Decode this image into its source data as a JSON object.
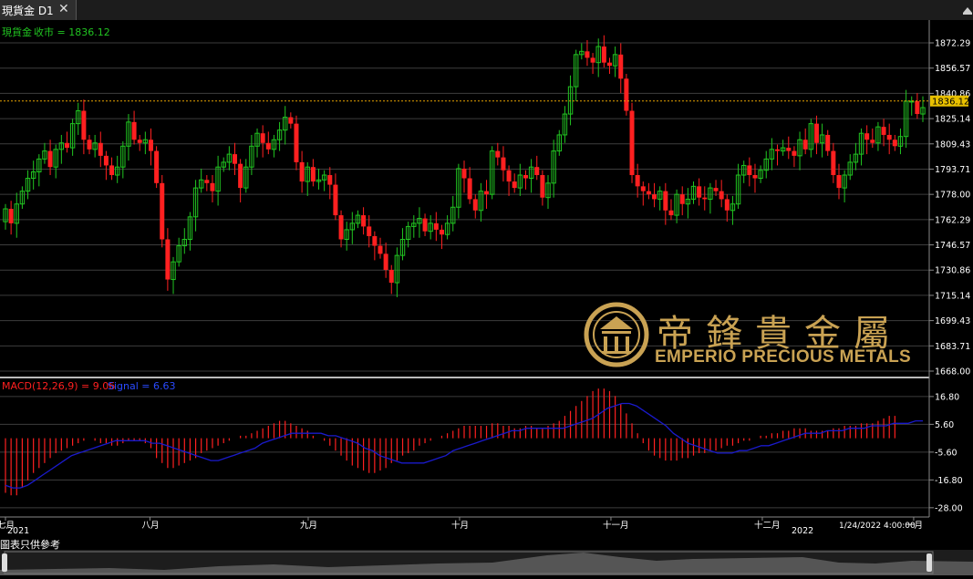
{
  "window": {
    "tab_title": "現貨金 D1",
    "close_glyph": "✕"
  },
  "price_panel": {
    "label_symbol": "現貨金",
    "label_text": "收市 = 1836.12",
    "label_color": "#21c421",
    "current_price": "1836.12",
    "current_line_color": "#e8a400"
  },
  "macd_panel": {
    "label_prefix": "MACD(12,26,9) = 9.06",
    "label_signal": "Signal = 6.63",
    "macd_color": "#ff2020",
    "signal_color": "#1a1acc"
  },
  "footer_note": "圖表只供參考",
  "timestamp": "1/24/2022 4:00:00",
  "logo": {
    "cn_text": "帝鋒貴金屬",
    "en_text": "EMPERIO PRECIOUS METALS",
    "color": "#c9a253"
  },
  "chart_data": [
    {
      "type": "candlestick",
      "title": "現貨金 D1",
      "series_label": "收市 = 1836.12",
      "ylim": [
        1668.0,
        1880.0
      ],
      "ytick_labels": [
        "1872.29",
        "1856.57",
        "1840.86",
        "1825.14",
        "1809.43",
        "1793.71",
        "1778.00",
        "1762.29",
        "1746.57",
        "1730.86",
        "1715.14",
        "1699.43",
        "1683.71",
        "1668.00"
      ],
      "xtick_labels": [
        "七月",
        "八月",
        "九月",
        "十月",
        "十一月",
        "十二月",
        "一月"
      ],
      "year_labels": [
        "2021",
        "2022"
      ],
      "colors": {
        "up": "#21c421",
        "down": "#ff2020"
      },
      "grid": true,
      "current": 1836.12,
      "close": [
        1769,
        1760,
        1772,
        1780,
        1788,
        1792,
        1800,
        1805,
        1795,
        1806,
        1810,
        1807,
        1822,
        1830,
        1812,
        1806,
        1810,
        1802,
        1796,
        1790,
        1795,
        1808,
        1823,
        1812,
        1810,
        1812,
        1805,
        1785,
        1750,
        1725,
        1736,
        1746,
        1750,
        1764,
        1782,
        1787,
        1785,
        1780,
        1795,
        1798,
        1803,
        1797,
        1782,
        1795,
        1808,
        1816,
        1810,
        1806,
        1812,
        1818,
        1826,
        1822,
        1798,
        1786,
        1795,
        1786,
        1787,
        1790,
        1784,
        1765,
        1750,
        1756,
        1760,
        1765,
        1758,
        1752,
        1746,
        1741,
        1731,
        1723,
        1740,
        1750,
        1758,
        1760,
        1763,
        1755,
        1760,
        1756,
        1753,
        1760,
        1770,
        1794,
        1788,
        1775,
        1768,
        1780,
        1778,
        1805,
        1801,
        1793,
        1786,
        1782,
        1790,
        1788,
        1795,
        1790,
        1776,
        1785,
        1805,
        1815,
        1828,
        1845,
        1865,
        1867,
        1863,
        1860,
        1870,
        1860,
        1858,
        1865,
        1850,
        1830,
        1790,
        1783,
        1780,
        1778,
        1775,
        1780,
        1768,
        1765,
        1778,
        1772,
        1775,
        1783,
        1776,
        1775,
        1782,
        1780,
        1775,
        1768,
        1772,
        1790,
        1796,
        1790,
        1788,
        1793,
        1800,
        1806,
        1805,
        1807,
        1805,
        1802,
        1812,
        1806,
        1822,
        1810,
        1815,
        1805,
        1790,
        1782,
        1790,
        1798,
        1803,
        1816,
        1812,
        1810,
        1820,
        1815,
        1812,
        1808,
        1814,
        1836,
        1836,
        1828,
        1832
      ]
    },
    {
      "type": "macd",
      "params": "12,26,9",
      "macd": 9.06,
      "signal": 6.63,
      "ylim": [
        -31,
        23
      ],
      "ytick_labels": [
        "16.80",
        "5.60",
        "-5.60",
        "-16.80",
        "-28.00"
      ],
      "histogram": [
        -22,
        -23,
        -23,
        -20,
        -17,
        -14,
        -12,
        -10,
        -8,
        -6,
        -5,
        -4,
        -3,
        -2,
        -1,
        0,
        -1,
        -2,
        -2,
        -3,
        -3,
        -2,
        -1,
        -1,
        -1,
        -2,
        -4,
        -8,
        -10,
        -12,
        -12,
        -11,
        -10,
        -9,
        -8,
        -6,
        -5,
        -4,
        -3,
        -2,
        -1,
        0,
        1,
        1,
        2,
        3,
        4,
        5,
        6,
        7,
        7,
        6,
        5,
        4,
        3,
        1,
        0,
        -1,
        -3,
        -5,
        -7,
        -9,
        -11,
        -12,
        -13,
        -14,
        -14,
        -13,
        -12,
        -10,
        -9,
        -7,
        -6,
        -5,
        -3,
        -2,
        -1,
        0,
        1,
        2,
        3,
        4,
        5,
        5,
        5,
        5,
        5,
        6,
        6,
        5,
        5,
        4,
        4,
        5,
        5,
        4,
        4,
        5,
        6,
        7,
        9,
        11,
        13,
        15,
        17,
        19,
        20,
        20,
        19,
        17,
        14,
        10,
        6,
        2,
        -2,
        -5,
        -7,
        -8,
        -9,
        -9,
        -9,
        -8,
        -8,
        -7,
        -6,
        -6,
        -5,
        -5,
        -4,
        -3,
        -3,
        -2,
        -1,
        -1,
        0,
        1,
        1,
        2,
        2,
        3,
        3,
        4,
        4,
        4,
        3,
        3,
        3,
        3,
        4,
        4,
        5,
        5,
        5,
        6,
        6,
        6,
        7,
        8,
        9,
        9
      ],
      "signal_line": [
        -19,
        -20,
        -20,
        -19,
        -17,
        -15,
        -13,
        -11,
        -9,
        -7,
        -6,
        -5,
        -4,
        -3,
        -2,
        -1,
        -1,
        -1,
        -1,
        -1,
        -2,
        -2,
        -3,
        -4,
        -5,
        -6,
        -7,
        -8,
        -9,
        -9,
        -8,
        -7,
        -6,
        -5,
        -4,
        -2,
        -1,
        0,
        1,
        2,
        2,
        2,
        2,
        2,
        1,
        1,
        0,
        -1,
        -2,
        -4,
        -5,
        -7,
        -8,
        -9,
        -10,
        -10,
        -10,
        -10,
        -9,
        -8,
        -7,
        -5,
        -4,
        -3,
        -2,
        -1,
        0,
        1,
        2,
        3,
        3,
        4,
        4,
        4,
        4,
        4,
        4,
        5,
        6,
        7,
        8,
        10,
        12,
        13,
        14,
        14,
        13,
        11,
        9,
        7,
        5,
        2,
        0,
        -2,
        -3,
        -4,
        -5,
        -6,
        -6,
        -6,
        -5,
        -5,
        -4,
        -3,
        -3,
        -2,
        -1,
        0,
        1,
        2,
        2,
        2,
        3,
        3,
        3,
        4,
        4,
        4,
        5,
        5,
        5,
        6,
        6,
        6,
        7,
        7
      ]
    }
  ]
}
